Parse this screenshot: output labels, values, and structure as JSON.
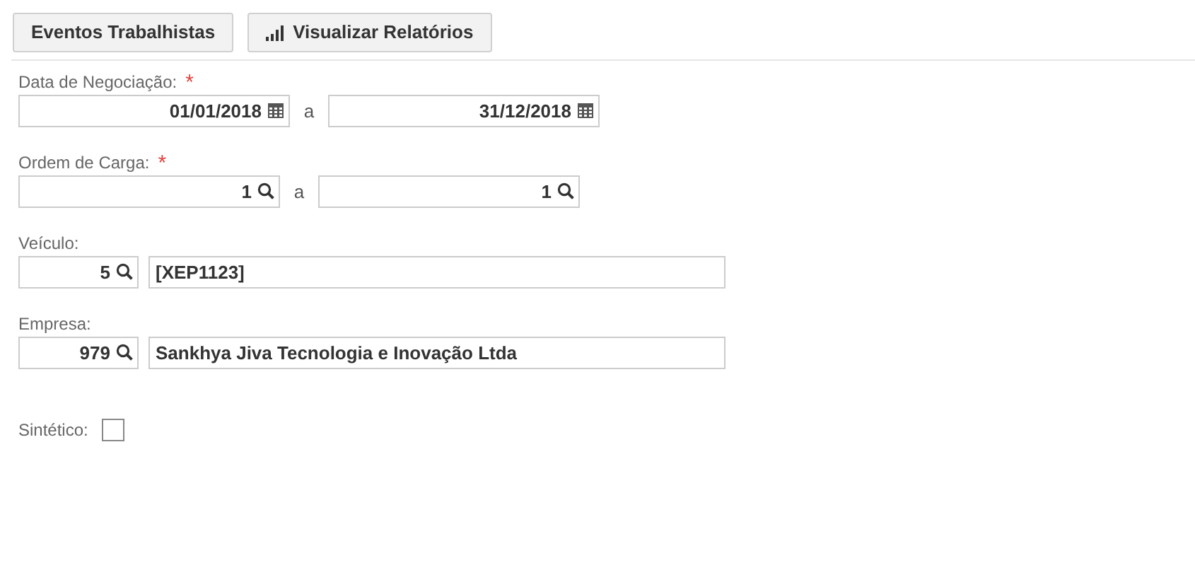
{
  "toolbar": [
    {
      "label": "Eventos Trabalhistas",
      "kind": "plain"
    },
    {
      "label": "Visualizar Relatórios",
      "kind": "report"
    }
  ],
  "filters": [
    {
      "kind": "date-range",
      "label": "Data de Negociação:",
      "required_mark": "*",
      "from": "01/01/2018",
      "separator": "a",
      "to": "31/12/2018"
    },
    {
      "kind": "search-range",
      "label": "Ordem de Carga:",
      "required_mark": "*",
      "from": "1",
      "separator": "a",
      "to": "1"
    },
    {
      "kind": "lookup",
      "label": "Veículo:",
      "code": "5",
      "description": "[XEP1123]"
    },
    {
      "kind": "lookup",
      "label": "Empresa:",
      "code": "979",
      "description": "Sankhya Jiva Tecnologia e Inovação Ltda"
    },
    {
      "kind": "checkbox",
      "label": "Sintético:",
      "checked": false
    }
  ]
}
